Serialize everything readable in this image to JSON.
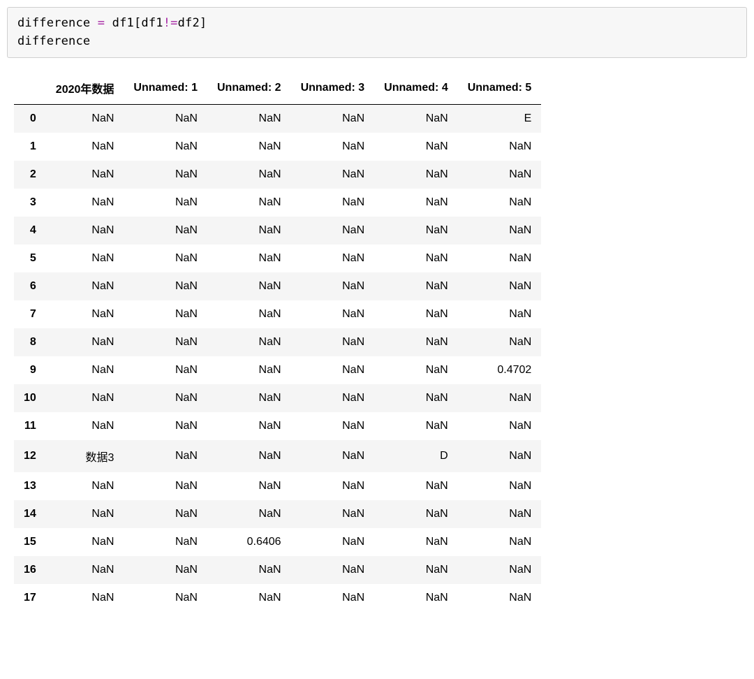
{
  "code": {
    "line1": {
      "t1": "difference ",
      "op1": "=",
      "t2": " df1[df1",
      "op2": "!=",
      "t3": "df2]"
    },
    "line2": "difference"
  },
  "table": {
    "columns": [
      "2020年数据",
      "Unnamed: 1",
      "Unnamed: 2",
      "Unnamed: 3",
      "Unnamed: 4",
      "Unnamed: 5"
    ],
    "index": [
      "0",
      "1",
      "2",
      "3",
      "4",
      "5",
      "6",
      "7",
      "8",
      "9",
      "10",
      "11",
      "12",
      "13",
      "14",
      "15",
      "16",
      "17"
    ],
    "rows": [
      [
        "NaN",
        "NaN",
        "NaN",
        "NaN",
        "NaN",
        "E"
      ],
      [
        "NaN",
        "NaN",
        "NaN",
        "NaN",
        "NaN",
        "NaN"
      ],
      [
        "NaN",
        "NaN",
        "NaN",
        "NaN",
        "NaN",
        "NaN"
      ],
      [
        "NaN",
        "NaN",
        "NaN",
        "NaN",
        "NaN",
        "NaN"
      ],
      [
        "NaN",
        "NaN",
        "NaN",
        "NaN",
        "NaN",
        "NaN"
      ],
      [
        "NaN",
        "NaN",
        "NaN",
        "NaN",
        "NaN",
        "NaN"
      ],
      [
        "NaN",
        "NaN",
        "NaN",
        "NaN",
        "NaN",
        "NaN"
      ],
      [
        "NaN",
        "NaN",
        "NaN",
        "NaN",
        "NaN",
        "NaN"
      ],
      [
        "NaN",
        "NaN",
        "NaN",
        "NaN",
        "NaN",
        "NaN"
      ],
      [
        "NaN",
        "NaN",
        "NaN",
        "NaN",
        "NaN",
        "0.4702"
      ],
      [
        "NaN",
        "NaN",
        "NaN",
        "NaN",
        "NaN",
        "NaN"
      ],
      [
        "NaN",
        "NaN",
        "NaN",
        "NaN",
        "NaN",
        "NaN"
      ],
      [
        "数据3",
        "NaN",
        "NaN",
        "NaN",
        "D",
        "NaN"
      ],
      [
        "NaN",
        "NaN",
        "NaN",
        "NaN",
        "NaN",
        "NaN"
      ],
      [
        "NaN",
        "NaN",
        "NaN",
        "NaN",
        "NaN",
        "NaN"
      ],
      [
        "NaN",
        "NaN",
        "0.6406",
        "NaN",
        "NaN",
        "NaN"
      ],
      [
        "NaN",
        "NaN",
        "NaN",
        "NaN",
        "NaN",
        "NaN"
      ],
      [
        "NaN",
        "NaN",
        "NaN",
        "NaN",
        "NaN",
        "NaN"
      ]
    ]
  }
}
